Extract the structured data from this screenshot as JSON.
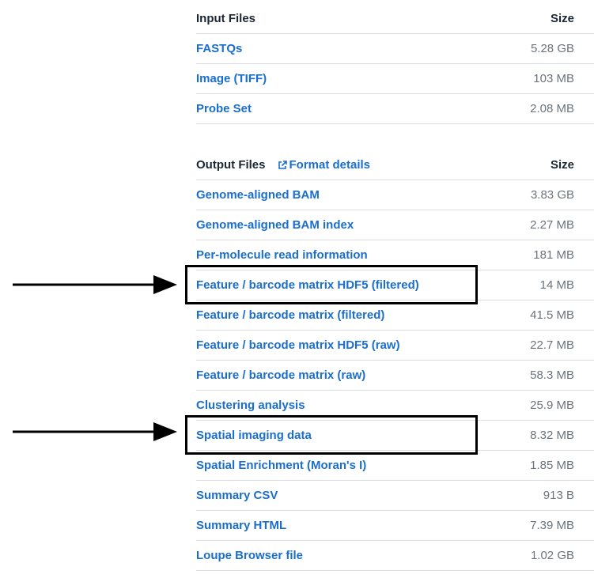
{
  "input_files": {
    "header": "Input Files",
    "size_header": "Size",
    "rows": [
      {
        "name": "FASTQs",
        "size": "5.28 GB"
      },
      {
        "name": "Image (TIFF)",
        "size": "103 MB"
      },
      {
        "name": "Probe Set",
        "size": "2.08 MB"
      }
    ]
  },
  "output_files": {
    "header": "Output Files",
    "format_link": "Format details",
    "size_header": "Size",
    "rows": [
      {
        "name": "Genome-aligned BAM",
        "size": "3.83 GB"
      },
      {
        "name": "Genome-aligned BAM index",
        "size": "2.27 MB"
      },
      {
        "name": "Per-molecule read information",
        "size": "181 MB"
      },
      {
        "name": "Feature / barcode matrix HDF5 (filtered)",
        "size": "14 MB"
      },
      {
        "name": "Feature / barcode matrix (filtered)",
        "size": "41.5 MB"
      },
      {
        "name": "Feature / barcode matrix HDF5 (raw)",
        "size": "22.7 MB"
      },
      {
        "name": "Feature / barcode matrix (raw)",
        "size": "58.3 MB"
      },
      {
        "name": "Clustering analysis",
        "size": "25.9 MB"
      },
      {
        "name": "Spatial imaging data",
        "size": "8.32 MB"
      },
      {
        "name": "Spatial Enrichment (Moran's I)",
        "size": "1.85 MB"
      },
      {
        "name": "Summary CSV",
        "size": "913 B"
      },
      {
        "name": "Summary HTML",
        "size": "7.39 MB"
      },
      {
        "name": "Loupe Browser file",
        "size": "1.02 GB"
      }
    ]
  },
  "icons": {
    "external_link": "external-link-icon",
    "arrow": "right-arrow-icon"
  },
  "colors": {
    "link": "#1a6ecf",
    "size_text": "#6b737c",
    "header_text": "#1c2733",
    "divider": "#d9dde2",
    "highlight_border": "#000000"
  }
}
